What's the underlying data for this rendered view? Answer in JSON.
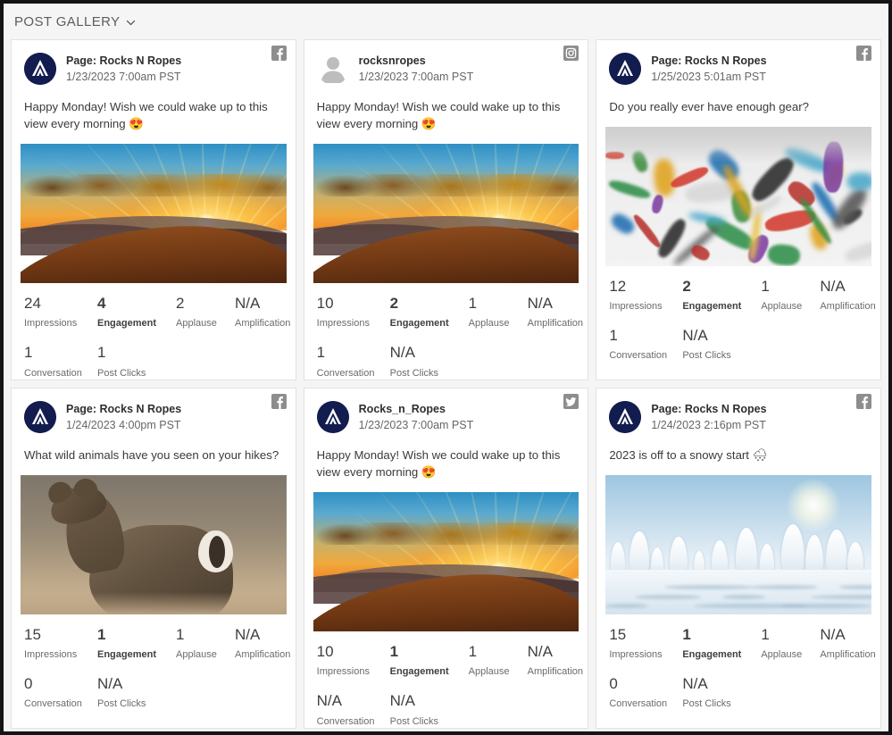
{
  "header": {
    "title": "POST GALLERY",
    "dropdown_icon": "chevron-down-icon"
  },
  "metric_labels": {
    "impressions": "Impressions",
    "engagement": "Engagement",
    "applause": "Applause",
    "amplification": "Amplification",
    "conversation": "Conversation",
    "post_clicks": "Post Clicks"
  },
  "colors": {
    "brand_navy": "#121c4e",
    "page_background": "#f5f5f5",
    "card_background": "#ffffff",
    "card_border": "#e2e2e2",
    "network_icon_gray": "#8d8d8d",
    "title_gray": "#5d5d5d"
  },
  "posts": [
    {
      "author": "Page: Rocks N Ropes",
      "timestamp": "1/23/2023 7:00am PST",
      "network": "facebook",
      "network_icon": "facebook-icon",
      "avatar": "brand-logo-avatar",
      "message": "Happy Monday! Wish we could wake up to this view every morning ",
      "emoji": "😍",
      "media": "sunset-mountain-photo",
      "metrics": {
        "impressions": "24",
        "engagement": "4",
        "applause": "2",
        "amplification": "N/A",
        "conversation": "1",
        "post_clicks": "1"
      }
    },
    {
      "author": "rocksnropes",
      "timestamp": "1/23/2023 7:00am PST",
      "network": "instagram",
      "network_icon": "instagram-icon",
      "avatar": "generic-person-avatar",
      "message": "Happy Monday! Wish we could wake up to this view every morning ",
      "emoji": "😍",
      "media": "sunset-mountain-photo",
      "metrics": {
        "impressions": "10",
        "engagement": "2",
        "applause": "1",
        "amplification": "N/A",
        "conversation": "1",
        "post_clicks": "N/A"
      }
    },
    {
      "author": "Page: Rocks N Ropes",
      "timestamp": "1/25/2023 5:01am PST",
      "network": "facebook",
      "network_icon": "facebook-icon",
      "avatar": "brand-logo-avatar",
      "message": "Do you really ever have enough gear?",
      "emoji": "",
      "media": "climbing-gear-photo",
      "metrics": {
        "impressions": "12",
        "engagement": "2",
        "applause": "1",
        "amplification": "N/A",
        "conversation": "1",
        "post_clicks": "N/A"
      }
    },
    {
      "author": "Page: Rocks N Ropes",
      "timestamp": "1/24/2023 4:00pm PST",
      "network": "facebook",
      "network_icon": "facebook-icon",
      "avatar": "brand-logo-avatar",
      "message": "What wild animals have you seen on your hikes?",
      "emoji": "",
      "media": "deer-photo",
      "metrics": {
        "impressions": "15",
        "engagement": "1",
        "applause": "1",
        "amplification": "N/A",
        "conversation": "0",
        "post_clicks": "N/A"
      }
    },
    {
      "author": "Rocks_n_Ropes",
      "timestamp": "1/23/2023 7:00am PST",
      "network": "twitter",
      "network_icon": "twitter-icon",
      "avatar": "brand-logo-avatar",
      "message": "Happy Monday! Wish we could wake up to this view every morning ",
      "emoji": "😍",
      "media": "sunset-mountain-photo",
      "metrics": {
        "impressions": "10",
        "engagement": "1",
        "applause": "1",
        "amplification": "N/A",
        "conversation": "N/A",
        "post_clicks": "N/A"
      }
    },
    {
      "author": "Page: Rocks N Ropes",
      "timestamp": "1/24/2023 2:16pm PST",
      "network": "facebook",
      "network_icon": "facebook-icon",
      "avatar": "brand-logo-avatar",
      "message": "2023 is off to a snowy start ",
      "emoji": "🌨",
      "media": "snowy-forest-photo",
      "metrics": {
        "impressions": "15",
        "engagement": "1",
        "applause": "1",
        "amplification": "N/A",
        "conversation": "0",
        "post_clicks": "N/A"
      }
    }
  ]
}
